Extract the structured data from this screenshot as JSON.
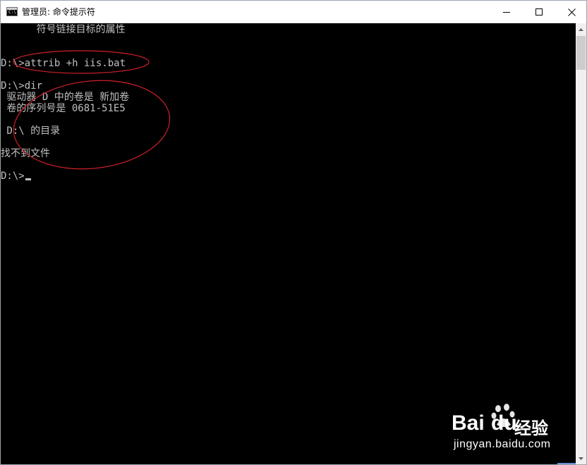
{
  "window": {
    "title": "管理员: 命令提示符",
    "icon": "cmd-icon",
    "controls": [
      "minimize-icon",
      "maximize-icon",
      "close-icon"
    ]
  },
  "console": {
    "lines": [
      "      符号链接目标的属性",
      "",
      "",
      "D:\\>attrib +h iis.bat",
      "",
      "D:\\>dir",
      " 驱动器 D 中的卷是 新加卷",
      " 卷的序列号是 0681-51E5",
      "",
      " D:\\ 的目录",
      "",
      "找不到文件",
      "",
      "D:\\>"
    ]
  },
  "annotations": {
    "color": "#d0202a",
    "shapes": [
      "ellipse-around-attrib-command",
      "ellipse-around-dir-output"
    ]
  },
  "watermark": {
    "brand_latin": "Bai",
    "brand_latin2": "du",
    "brand_cn": "经验",
    "url": "jingyan.baidu.com"
  },
  "colors": {
    "console_bg": "#000000",
    "console_text": "#c0c0c0",
    "titlebar_bg": "#ffffff",
    "annotation": "#d0202a"
  }
}
